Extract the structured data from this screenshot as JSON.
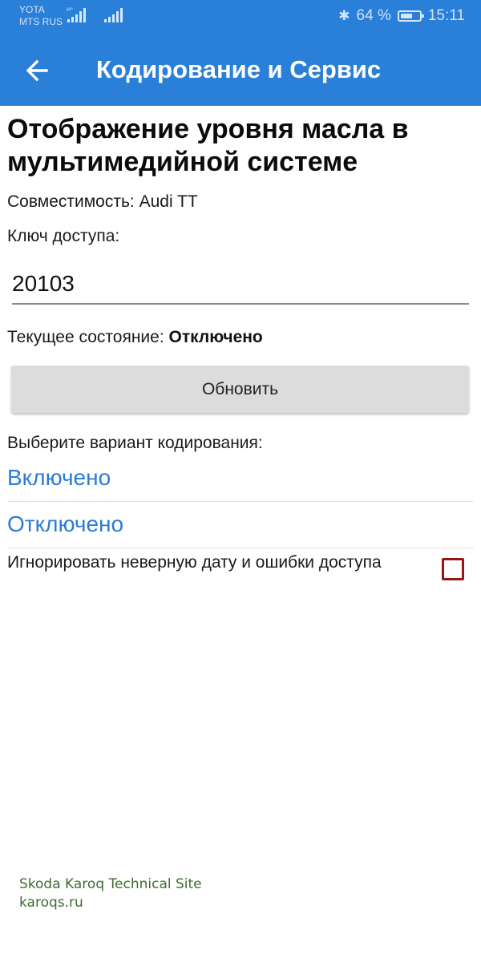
{
  "status_bar": {
    "carrier_1": "YOTA",
    "carrier_2": "MTS RUS",
    "battery_percent": "64 %",
    "battery_level": 0.64,
    "time": "15:11"
  },
  "app_bar": {
    "title": "Кодирование и Сервис"
  },
  "content": {
    "heading": "Отображение уровня масла в мультимедийной системе",
    "compatibility": "Совместимость: Audi TT",
    "access_key_label": "Ключ доступа:",
    "access_key_value": "20103",
    "current_state_label": "Текущее состояние: ",
    "current_state_value": "Отключено",
    "refresh_button": "Обновить",
    "choose_label": "Выберите вариант кодирования:",
    "options": [
      "Включено",
      "Отключено"
    ],
    "ignore_label": "Игнорировать неверную дату и ошибки доступа",
    "ignore_checked": false
  },
  "watermark": {
    "line1": "Skoda Karoq Technical Site",
    "line2": "karoqs.ru"
  }
}
